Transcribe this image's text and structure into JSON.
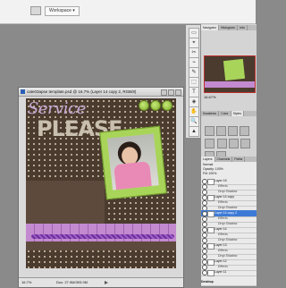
{
  "toolbar": {
    "workspace_label": "Workspace ▾"
  },
  "document": {
    "title": "cate03apse template.psd @ 16.7% (Layer 14 copy 2, RGB/8)",
    "canvas_text_1": "Service",
    "canvas_text_2": "PLEASE",
    "status_zoom": "16.7%",
    "status_doc": "Doc: 27.9M/393.9M"
  },
  "tools": {
    "items": [
      "▭",
      "⌖",
      "✂",
      "⌁",
      "✎",
      "⬚",
      "T",
      "◈",
      "✋",
      "🔍",
      "▲"
    ]
  },
  "navigator": {
    "tabs": [
      "Navigator",
      "Histogram",
      "Info"
    ],
    "zoom": "16.67%"
  },
  "swatch_panel": {
    "tabs": [
      "Swatches",
      "Color",
      "Styles"
    ]
  },
  "layers_panel": {
    "tabs": [
      "Layers",
      "Channels",
      "Paths"
    ],
    "blend": "Normal",
    "opacity_label": "Opacity: 100%",
    "fill_label": "Fill: 100%",
    "items": [
      {
        "name": "Layer 15",
        "type": "layer"
      },
      {
        "name": "Effects",
        "type": "sub"
      },
      {
        "name": "Drop Shadow",
        "type": "sub"
      },
      {
        "name": "Layer 14 copy",
        "type": "layer"
      },
      {
        "name": "Effects",
        "type": "sub"
      },
      {
        "name": "Drop Shadow",
        "type": "sub"
      },
      {
        "name": "Layer 14 copy 2",
        "type": "selected"
      },
      {
        "name": "Effects",
        "type": "sub"
      },
      {
        "name": "Drop Shadow",
        "type": "sub"
      },
      {
        "name": "Layer 14",
        "type": "layer"
      },
      {
        "name": "Effects",
        "type": "sub"
      },
      {
        "name": "Drop Shadow",
        "type": "sub"
      },
      {
        "name": "Layer 13",
        "type": "layer"
      },
      {
        "name": "Effects",
        "type": "sub"
      },
      {
        "name": "Drop Shadow",
        "type": "sub"
      },
      {
        "name": "Layer 12",
        "type": "layer"
      },
      {
        "name": "Effects",
        "type": "sub"
      },
      {
        "name": "Layer 11",
        "type": "layer"
      }
    ],
    "footer": "Desktop"
  },
  "colors": {
    "background_gray": "#8a8a8a",
    "accent_green": "#a8d45a",
    "accent_purple": "#c38ad0",
    "selection_blue": "#3d7ad6"
  }
}
